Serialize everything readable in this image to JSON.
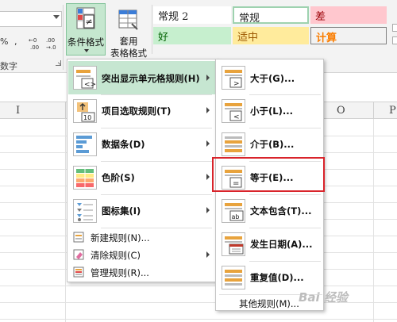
{
  "ribbon": {
    "number_format_row": [
      "%",
      ",",
      "€0\n.00",
      ".00\n→.0"
    ],
    "number_group_label": "数字",
    "conditional_format_label": "条件格式",
    "table_format_line1": "套用",
    "table_format_line2": "表格格式",
    "cell_styles": {
      "normal2": "常规 2",
      "normal": "常规",
      "bad": "差",
      "good": "好",
      "neutral": "适中",
      "calc": "计算"
    }
  },
  "grid": {
    "col_letters": [
      "I",
      "O",
      "P"
    ]
  },
  "menu_cf": {
    "items": [
      {
        "label": "突出显示单元格规则(H)",
        "submenu": true
      },
      {
        "label": "项目选取规则(T)",
        "submenu": true
      },
      {
        "label": "数据条(D)",
        "submenu": true
      },
      {
        "label": "色阶(S)",
        "submenu": true
      },
      {
        "label": "图标集(I)",
        "submenu": true
      }
    ],
    "commands": [
      {
        "label": "新建规则(N)..."
      },
      {
        "label": "清除规则(C)",
        "submenu": true
      },
      {
        "label": "管理规则(R)..."
      }
    ]
  },
  "menu_highlight": {
    "items": [
      {
        "label": "大于(G)..."
      },
      {
        "label": "小于(L)..."
      },
      {
        "label": "介于(B)..."
      },
      {
        "label": "等于(E)..."
      },
      {
        "label": "文本包含(T)..."
      },
      {
        "label": "发生日期(A)..."
      },
      {
        "label": "重复值(D)..."
      }
    ],
    "other_rules": "其他规则(M)..."
  },
  "watermark": "Bai 经验",
  "colors": {
    "accent_green": "#c6e6d1",
    "highlight_red": "#d9242b",
    "bad_fill": "#ffc7ce",
    "good_fill": "#c6efce",
    "neutral_fill": "#ffeb9c"
  }
}
